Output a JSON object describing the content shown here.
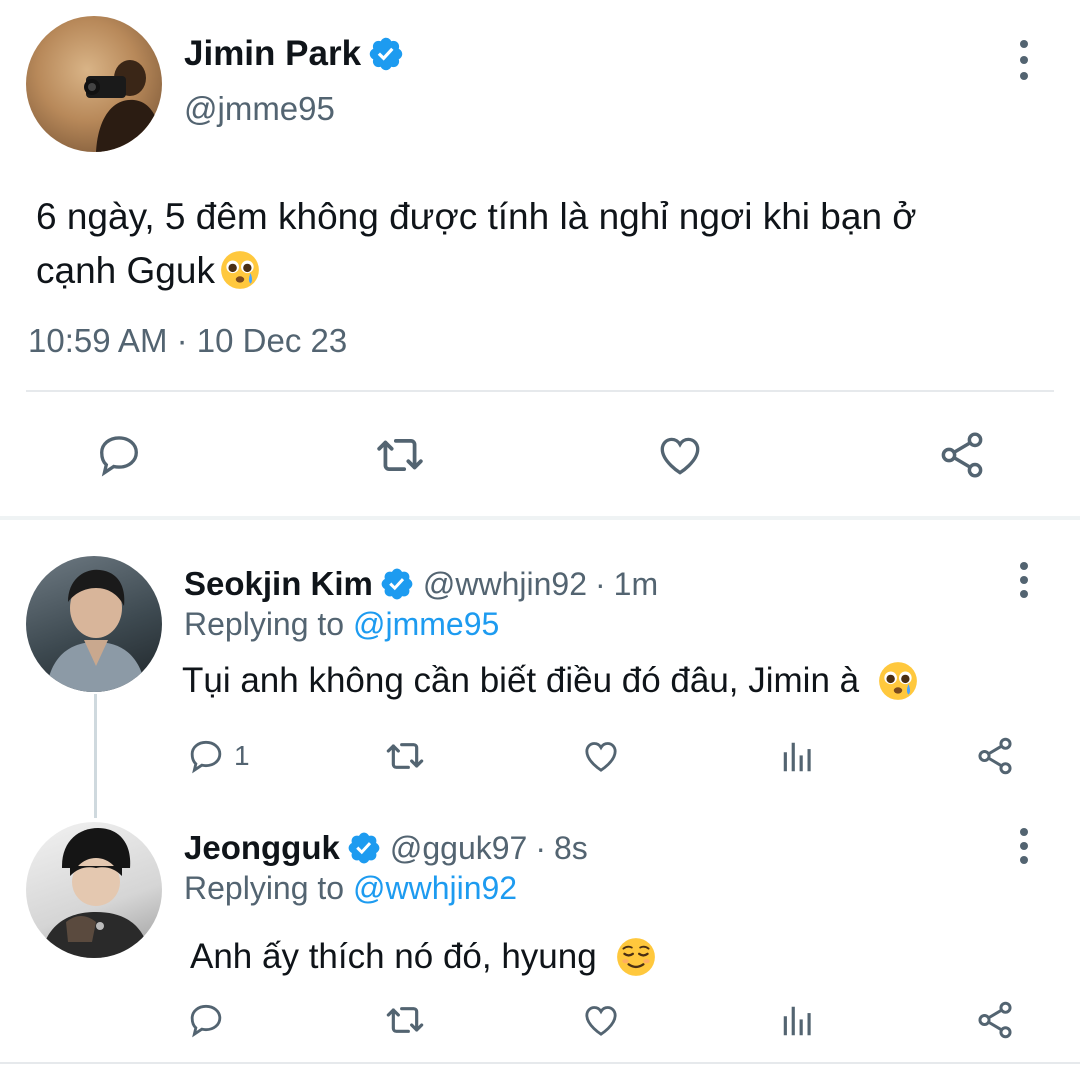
{
  "main_tweet": {
    "author_name": "Jimin Park",
    "handle": "@jmme95",
    "text": "6 ngày, 5 đêm không được tính là nghỉ ngơi khi bạn ở",
    "text_line2": "cạnh Gguk",
    "emoji": "crying-pleading-face",
    "time": "10:59 AM",
    "separator": "·",
    "date": "10 Dec 23",
    "actions": [
      "reply-icon",
      "retweet-icon",
      "like-icon",
      "share-icon"
    ]
  },
  "replies": [
    {
      "author_name": "Seokjin Kim",
      "handle": "@wwhjin92",
      "separator": "·",
      "time_ago": "1m",
      "replying_prefix": "Replying to",
      "replying_to": "@jmme95",
      "text": "Tụi anh không cần biết điều đó đâu, Jimin à",
      "emoji": "crying-pleading-face",
      "reply_count": "1"
    },
    {
      "author_name": "Jeongguk",
      "handle": "@gguk97",
      "separator": "·",
      "time_ago": "8s",
      "replying_prefix": "Replying to",
      "replying_to": "@wwhjin92",
      "text": "Anh ấy thích nó đó, hyung",
      "emoji": "relieved-face",
      "reply_count": ""
    }
  ],
  "colors": {
    "accent": "#1d9bf0",
    "text": "#0f1419",
    "muted": "#536471",
    "divider": "#e6e9ec",
    "emoji_yellow": "#ffc83d"
  }
}
